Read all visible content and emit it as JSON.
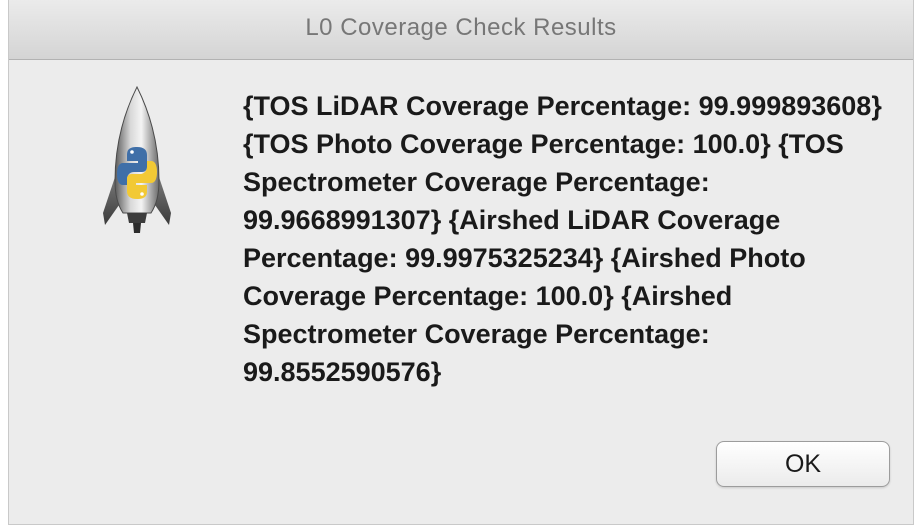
{
  "dialog": {
    "title": "L0 Coverage Check Results",
    "icon": "python-rocket-icon",
    "message": "{TOS LiDAR Coverage Percentage: 99.999893608} {TOS Photo Coverage Percentage: 100.0} {TOS Spectrometer Coverage Percentage: 99.9668991307} {Airshed LiDAR Coverage Percentage: 99.9975325234} {Airshed Photo Coverage Percentage: 100.0} {Airshed Spectrometer Coverage Percentage: 99.8552590576}",
    "ok_label": "OK"
  }
}
